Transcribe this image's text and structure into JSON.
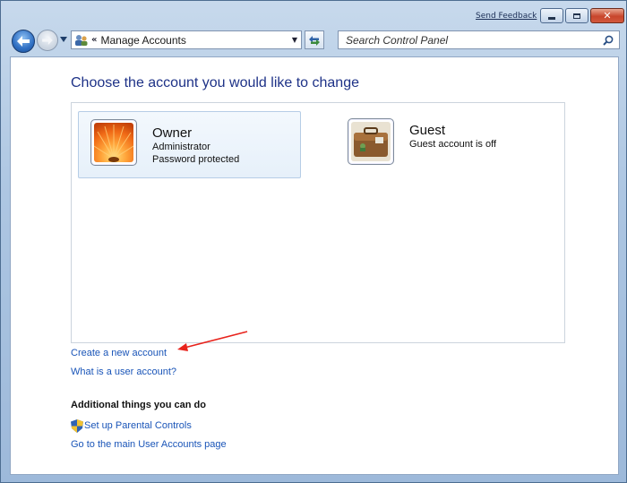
{
  "titlebar": {
    "feedback_label": "Send Feedback",
    "minimize_label": "Minimize",
    "maximize_label": "Maximize",
    "close_label": "Close"
  },
  "navbar": {
    "address_chevron": "«",
    "address_crumb": "Manage Accounts",
    "search_placeholder": "Search Control Panel"
  },
  "main": {
    "heading": "Choose the account you would like to change",
    "accounts": [
      {
        "name": "Owner",
        "lines": [
          "Administrator",
          "Password protected"
        ],
        "icon": "flower-picture-icon",
        "selected": true
      },
      {
        "name": "Guest",
        "lines": [
          "Guest account is off"
        ],
        "icon": "suitcase-picture-icon",
        "selected": false
      }
    ],
    "links": {
      "create_account": "Create a new account",
      "what_is_account": "What is a user account?"
    },
    "additional": {
      "heading": "Additional things you can do",
      "parental_controls": "Set up Parental Controls",
      "main_accounts_page": "Go to the main User Accounts page"
    }
  },
  "annotation": {
    "arrow_color": "#e8231c",
    "icon": "red-arrow-icon"
  },
  "colors": {
    "heading": "#1e3287",
    "link": "#1a55b8"
  }
}
